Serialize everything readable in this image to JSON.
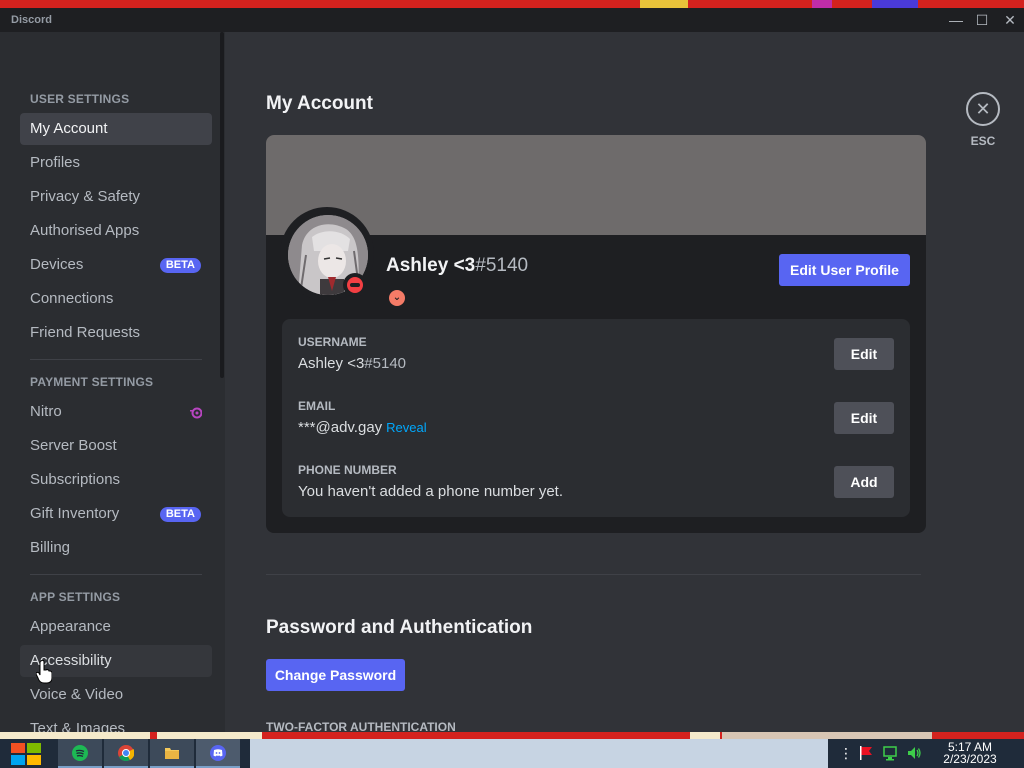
{
  "window": {
    "title": "Discord",
    "controls": [
      "—",
      "☐",
      "✕"
    ]
  },
  "sidebar": {
    "user_settings_header": "USER SETTINGS",
    "user_items": [
      {
        "label": "My Account"
      },
      {
        "label": "Profiles"
      },
      {
        "label": "Privacy & Safety"
      },
      {
        "label": "Authorised Apps"
      },
      {
        "label": "Devices",
        "badge": "BETA"
      },
      {
        "label": "Connections"
      },
      {
        "label": "Friend Requests"
      }
    ],
    "payment_settings_header": "PAYMENT SETTINGS",
    "payment_items": [
      {
        "label": "Nitro"
      },
      {
        "label": "Server Boost"
      },
      {
        "label": "Subscriptions"
      },
      {
        "label": "Gift Inventory",
        "badge": "BETA"
      },
      {
        "label": "Billing"
      }
    ],
    "app_settings_header": "APP SETTINGS",
    "app_items": [
      {
        "label": "Appearance"
      },
      {
        "label": "Accessibility"
      },
      {
        "label": "Voice & Video"
      },
      {
        "label": "Text & Images"
      }
    ],
    "selected": "My Account",
    "hovered": "Accessibility"
  },
  "main": {
    "page_title": "My Account",
    "esc_label": "ESC",
    "close_glyph": "✕",
    "profile": {
      "display_name": "Ashley <3",
      "discriminator": "#5140",
      "edit_profile_button": "Edit User Profile",
      "nitro_glyph": "⌄"
    },
    "fields": {
      "username_label": "USERNAME",
      "username_name": "Ashley <3",
      "username_tag": "#5140",
      "username_button": "Edit",
      "email_label": "EMAIL",
      "email_value": "***@adv.gay",
      "email_reveal": "Reveal",
      "email_button": "Edit",
      "phone_label": "PHONE NUMBER",
      "phone_value": "You haven't added a phone number yet.",
      "phone_button": "Add"
    },
    "password_section_title": "Password and Authentication",
    "change_password_button": "Change Password",
    "two_factor_header": "TWO-FACTOR AUTHENTICATION"
  },
  "taskbar": {
    "clock_time": "5:17 AM",
    "clock_date": "2/23/2023"
  },
  "colors": {
    "blurple": "#5865f2",
    "dnd_red": "#f23f43",
    "link_blue": "#00a8fc",
    "banner": "#6e6b6b"
  }
}
